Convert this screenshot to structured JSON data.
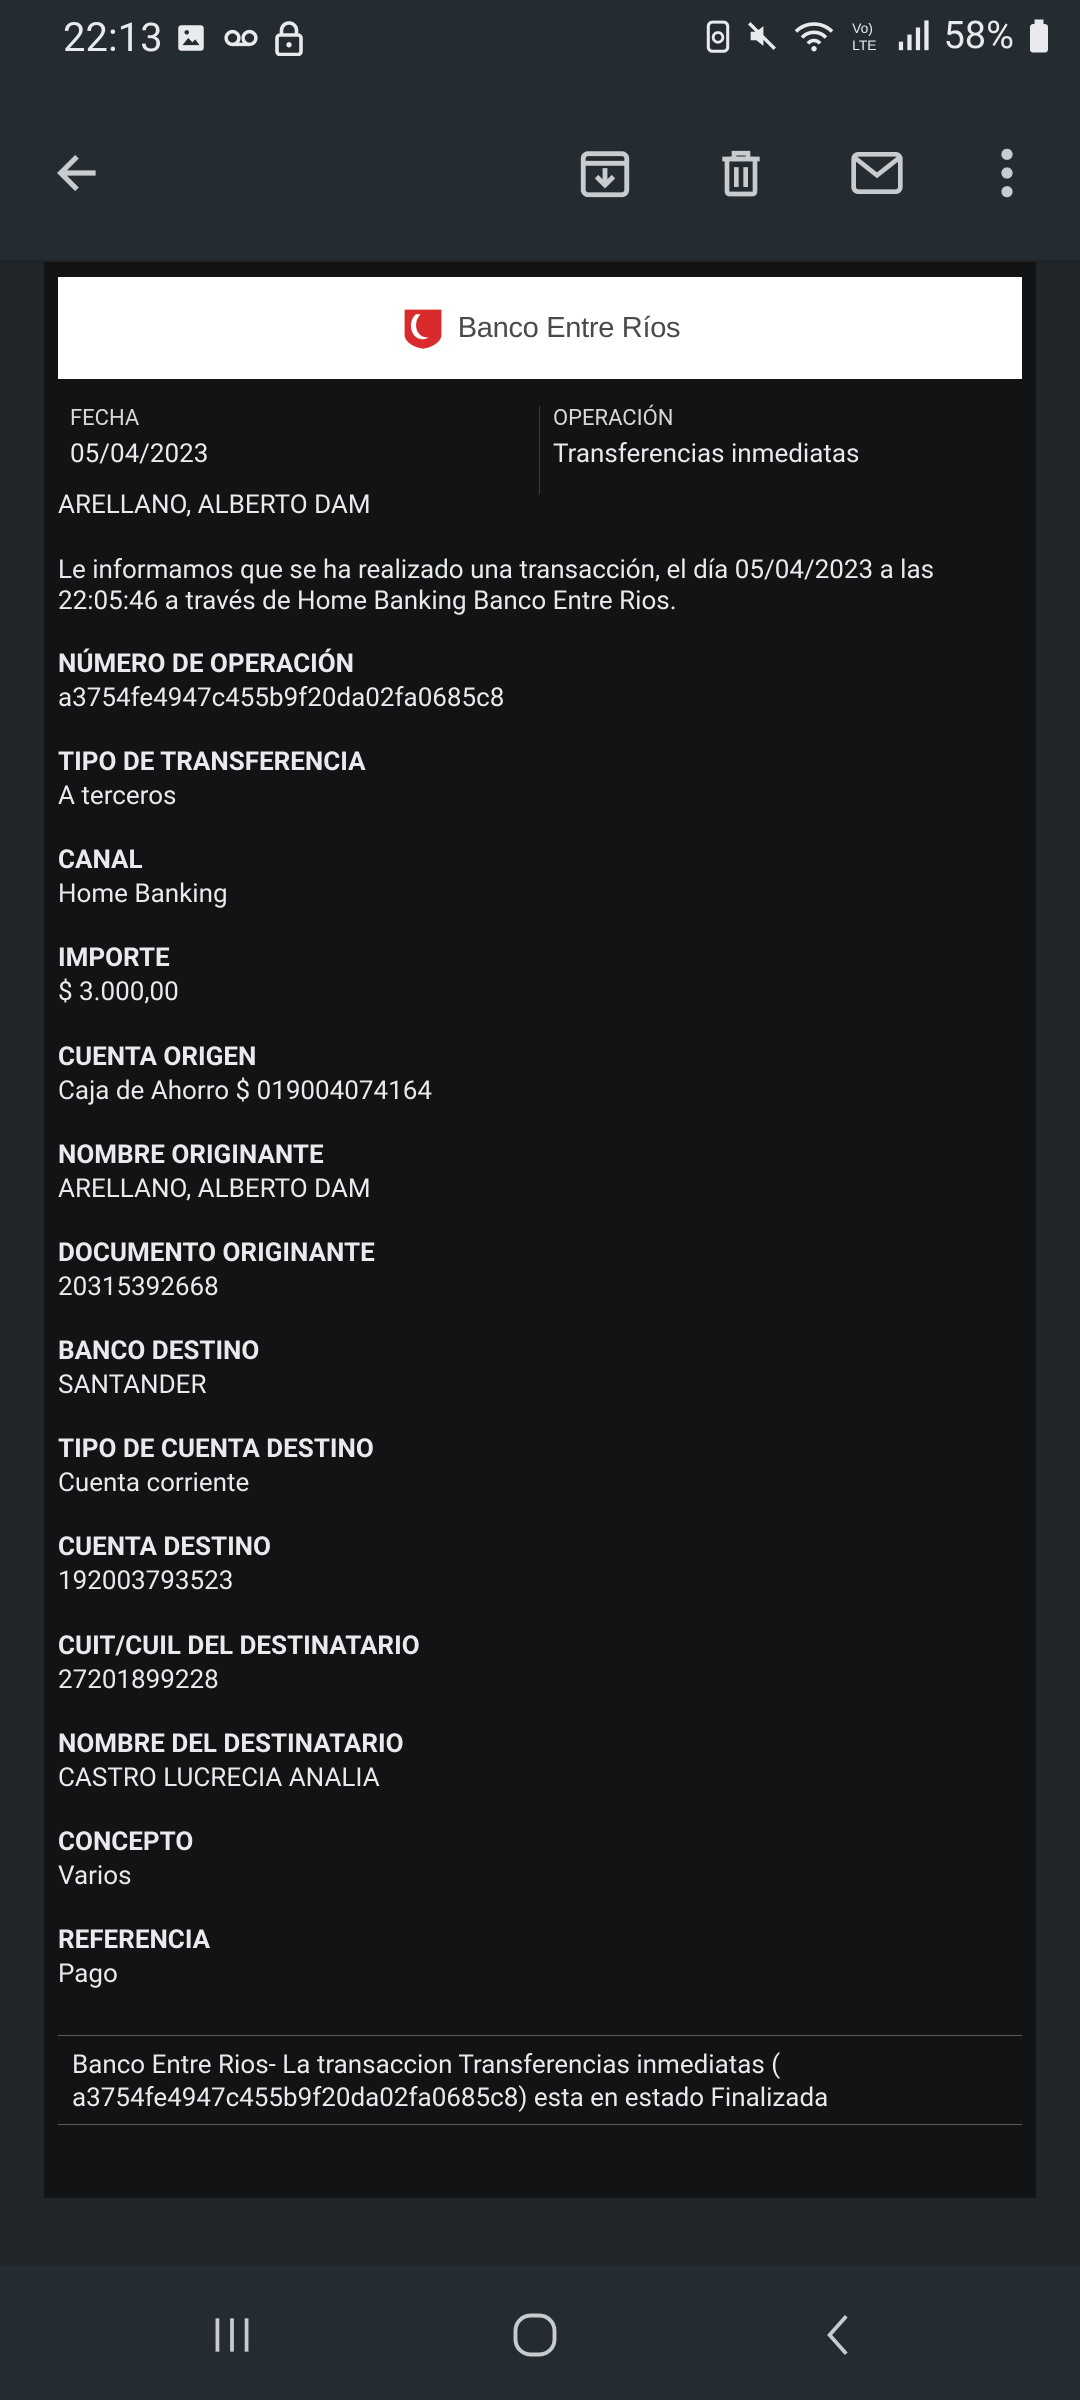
{
  "status_bar": {
    "time": "22:13",
    "battery": "58%",
    "icons": [
      "gallery-icon",
      "voicemail-icon",
      "lock-icon",
      "recycle-icon",
      "mute-icon",
      "wifi-icon",
      "volte-icon",
      "signal-icon",
      "battery-icon"
    ]
  },
  "app_bar": {
    "icons": [
      "back-arrow-icon",
      "archive-icon",
      "delete-icon",
      "mail-icon",
      "more-vert-icon"
    ]
  },
  "email": {
    "logo_text": "Banco Entre Ríos",
    "meta": {
      "fecha_label": "FECHA",
      "fecha_value": "05/04/2023",
      "operacion_label": "OPERACIÓN",
      "operacion_value": "Transferencias inmediatas"
    },
    "name_line": "ARELLANO, ALBERTO DAM",
    "intro": "Le informamos que se ha realizado una transacción, el día 05/04/2023 a las 22:05:46 a través de Home Banking Banco Entre Rios.",
    "fields": [
      {
        "label": "NÚMERO DE OPERACIÓN",
        "value": "a3754fe4947c455b9f20da02fa0685c8"
      },
      {
        "label": "TIPO DE TRANSFERENCIA",
        "value": "A terceros"
      },
      {
        "label": "CANAL",
        "value": "Home Banking"
      },
      {
        "label": "IMPORTE",
        "value": "$ 3.000,00"
      },
      {
        "label": "CUENTA ORIGEN",
        "value": "Caja de Ahorro $ 019004074164"
      },
      {
        "label": "NOMBRE ORIGINANTE",
        "value": "ARELLANO, ALBERTO DAM"
      },
      {
        "label": "DOCUMENTO ORIGINANTE",
        "value": "20315392668"
      },
      {
        "label": "BANCO DESTINO",
        "value": "SANTANDER"
      },
      {
        "label": "TIPO DE CUENTA DESTINO",
        "value": "Cuenta corriente"
      },
      {
        "label": "CUENTA DESTINO",
        "value": "192003793523"
      },
      {
        "label": "CUIT/CUIL DEL DESTINATARIO",
        "value": "27201899228"
      },
      {
        "label": "NOMBRE DEL DESTINATARIO",
        "value": "CASTRO LUCRECIA ANALIA"
      },
      {
        "label": "CONCEPTO",
        "value": "Varios"
      },
      {
        "label": "REFERENCIA",
        "value": "Pago"
      }
    ],
    "footer": "Banco Entre Rios- La transaccion Transferencias inmediatas ( a3754fe4947c455b9f20da02fa0685c8) esta en estado Finalizada"
  },
  "nav_bar": {
    "icons": [
      "recent-apps-icon",
      "home-icon",
      "back-icon"
    ]
  },
  "colors": {
    "brand_red": "#d92b2b",
    "background": "#1f2529",
    "card": "#121314",
    "text": "#e8eaed"
  }
}
